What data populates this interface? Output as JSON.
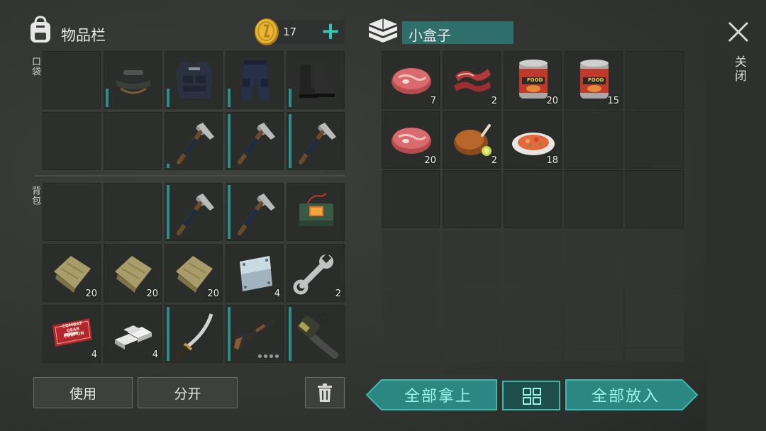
{
  "inventory": {
    "title": "物品栏",
    "coins": "17",
    "add_label": "+",
    "pocket_label": "口袋",
    "backpack_label": "背包",
    "pocket_slots": [
      {
        "item": "",
        "qty": ""
      },
      {
        "item": "tactical-helmet",
        "qty": ""
      },
      {
        "item": "police-vest",
        "qty": ""
      },
      {
        "item": "police-pants",
        "qty": ""
      },
      {
        "item": "combat-boots",
        "qty": ""
      },
      {
        "item": "",
        "qty": ""
      },
      {
        "item": "",
        "qty": ""
      },
      {
        "item": "hatchet",
        "qty": ""
      },
      {
        "item": "hatchet",
        "qty": ""
      },
      {
        "item": "hatchet",
        "qty": ""
      }
    ],
    "backpack_slots": [
      {
        "item": "",
        "qty": ""
      },
      {
        "item": "",
        "qty": ""
      },
      {
        "item": "hatchet",
        "qty": ""
      },
      {
        "item": "hatchet",
        "qty": ""
      },
      {
        "item": "explosive-device",
        "qty": ""
      },
      {
        "item": "cloth",
        "qty": "20"
      },
      {
        "item": "cloth",
        "qty": "20"
      },
      {
        "item": "cloth",
        "qty": "20"
      },
      {
        "item": "metal-plate",
        "qty": "4"
      },
      {
        "item": "wrench",
        "qty": "2"
      },
      {
        "item": "combat-coupon",
        "qty": "4"
      },
      {
        "item": "iron-bars",
        "qty": "4"
      },
      {
        "item": "sword",
        "qty": ""
      },
      {
        "item": "pump-shotgun",
        "qty": ""
      },
      {
        "item": "chainsaw",
        "qty": ""
      }
    ],
    "coupon_text": "COMBAT GEAR COUPON",
    "use_label": "使用",
    "split_label": "分开"
  },
  "box": {
    "title": "小盒子",
    "slots": [
      {
        "item": "raw-steak",
        "qty": "7"
      },
      {
        "item": "bacon",
        "qty": "2"
      },
      {
        "item": "canned-food",
        "qty": "20"
      },
      {
        "item": "canned-food",
        "qty": "15"
      },
      {
        "item": "",
        "qty": ""
      },
      {
        "item": "raw-steak",
        "qty": "20"
      },
      {
        "item": "roast-chicken",
        "qty": "2"
      },
      {
        "item": "cooked-dish",
        "qty": "18"
      }
    ],
    "can_label": "FOOD",
    "take_all_label": "全部拿上",
    "put_all_label": "全部放入"
  },
  "close": {
    "label": "关闭"
  },
  "colors": {
    "accent": "#2f9b95",
    "bar": "#2a8f8a",
    "text_teal": "#9ff4ea"
  }
}
